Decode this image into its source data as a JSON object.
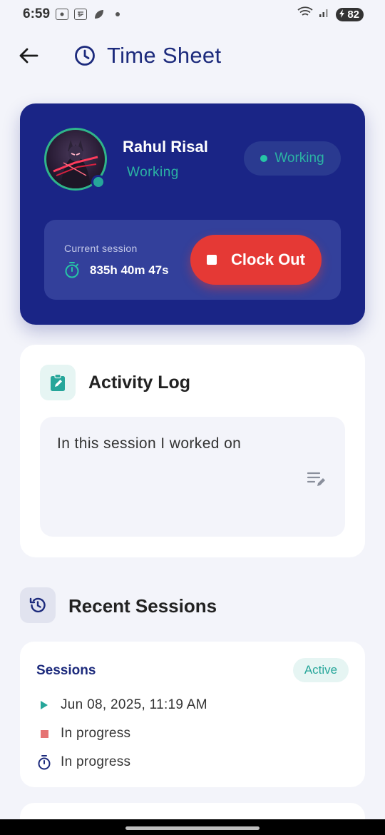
{
  "status_bar": {
    "time": "6:59",
    "icons": [
      "screen-record-icon",
      "rupee-app-icon",
      "leaf-icon",
      "dot-icon"
    ],
    "battery": "82"
  },
  "app_bar": {
    "title": "Time Sheet",
    "back_icon": "arrow-back-icon",
    "title_icon": "clock-icon"
  },
  "profile": {
    "name": "Rahul Risal",
    "status": "Working",
    "status_pill": "Working",
    "online": true
  },
  "current_session": {
    "label": "Current session",
    "elapsed": "835h 40m 47s",
    "clock_out_label": "Clock Out"
  },
  "activity_log": {
    "title": "Activity Log",
    "value": "In this session I worked on",
    "placeholder": "In this session I worked on"
  },
  "recent_sessions": {
    "title": "Recent Sessions",
    "items": [
      {
        "title": "Sessions",
        "badge": "Active",
        "start": "Jun 08, 2025, 11:19 AM",
        "end": "In progress",
        "duration": "In progress"
      }
    ]
  },
  "colors": {
    "primary": "#1a2586",
    "accent_teal": "#26a69a",
    "danger": "#e53935",
    "background": "#f3f4fa"
  }
}
